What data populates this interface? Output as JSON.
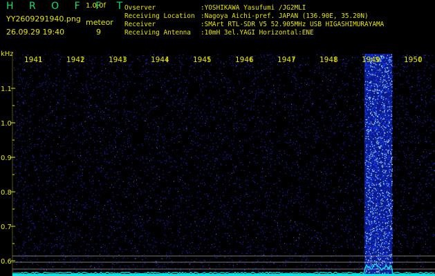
{
  "header": {
    "app_title": "H R O F F T",
    "app_version": "1.0.0f",
    "file_name": "YY2609291940.png",
    "timestamp": "26.09.29 19:40",
    "mode_label": "meteor",
    "mode_value": "9"
  },
  "station_info": [
    {
      "key": "Ovserver",
      "value": ":YOSHIKAWA Yasufumi /JG2MLI"
    },
    {
      "key": "Receiving Location",
      "value": ":Nagoya Aichi-pref. JAPAN (136.90E, 35.20N)"
    },
    {
      "key": "Receiver",
      "value": ":SMArt RTL-SDR V5 52.905MHz USB HIGASHIMURAYAMA"
    },
    {
      "key": "Receiving Antenna",
      "value": ":10mH 3el.YAGI Horizontal:ENE"
    }
  ],
  "spectrogram": {
    "y_unit": "kHz",
    "y_ticks": [
      "1.1",
      "1.0",
      "0.9",
      "0.8",
      "0.7",
      "0.6"
    ],
    "time_ticks": [
      "1941",
      "1942",
      "1943",
      "1944",
      "1945",
      "1946",
      "1947",
      "1948",
      "1949",
      "1950"
    ],
    "colors": {
      "background": "#000000",
      "noise_floor": "#1e1ea0",
      "burst": "#1a3cff",
      "burst_hot": "#9ad8ff",
      "baseline": "#00e6e6",
      "axis_text": "#e6e600",
      "grid_line": "#c8c8c8"
    },
    "burst_minutes": [
      "1949"
    ]
  }
}
